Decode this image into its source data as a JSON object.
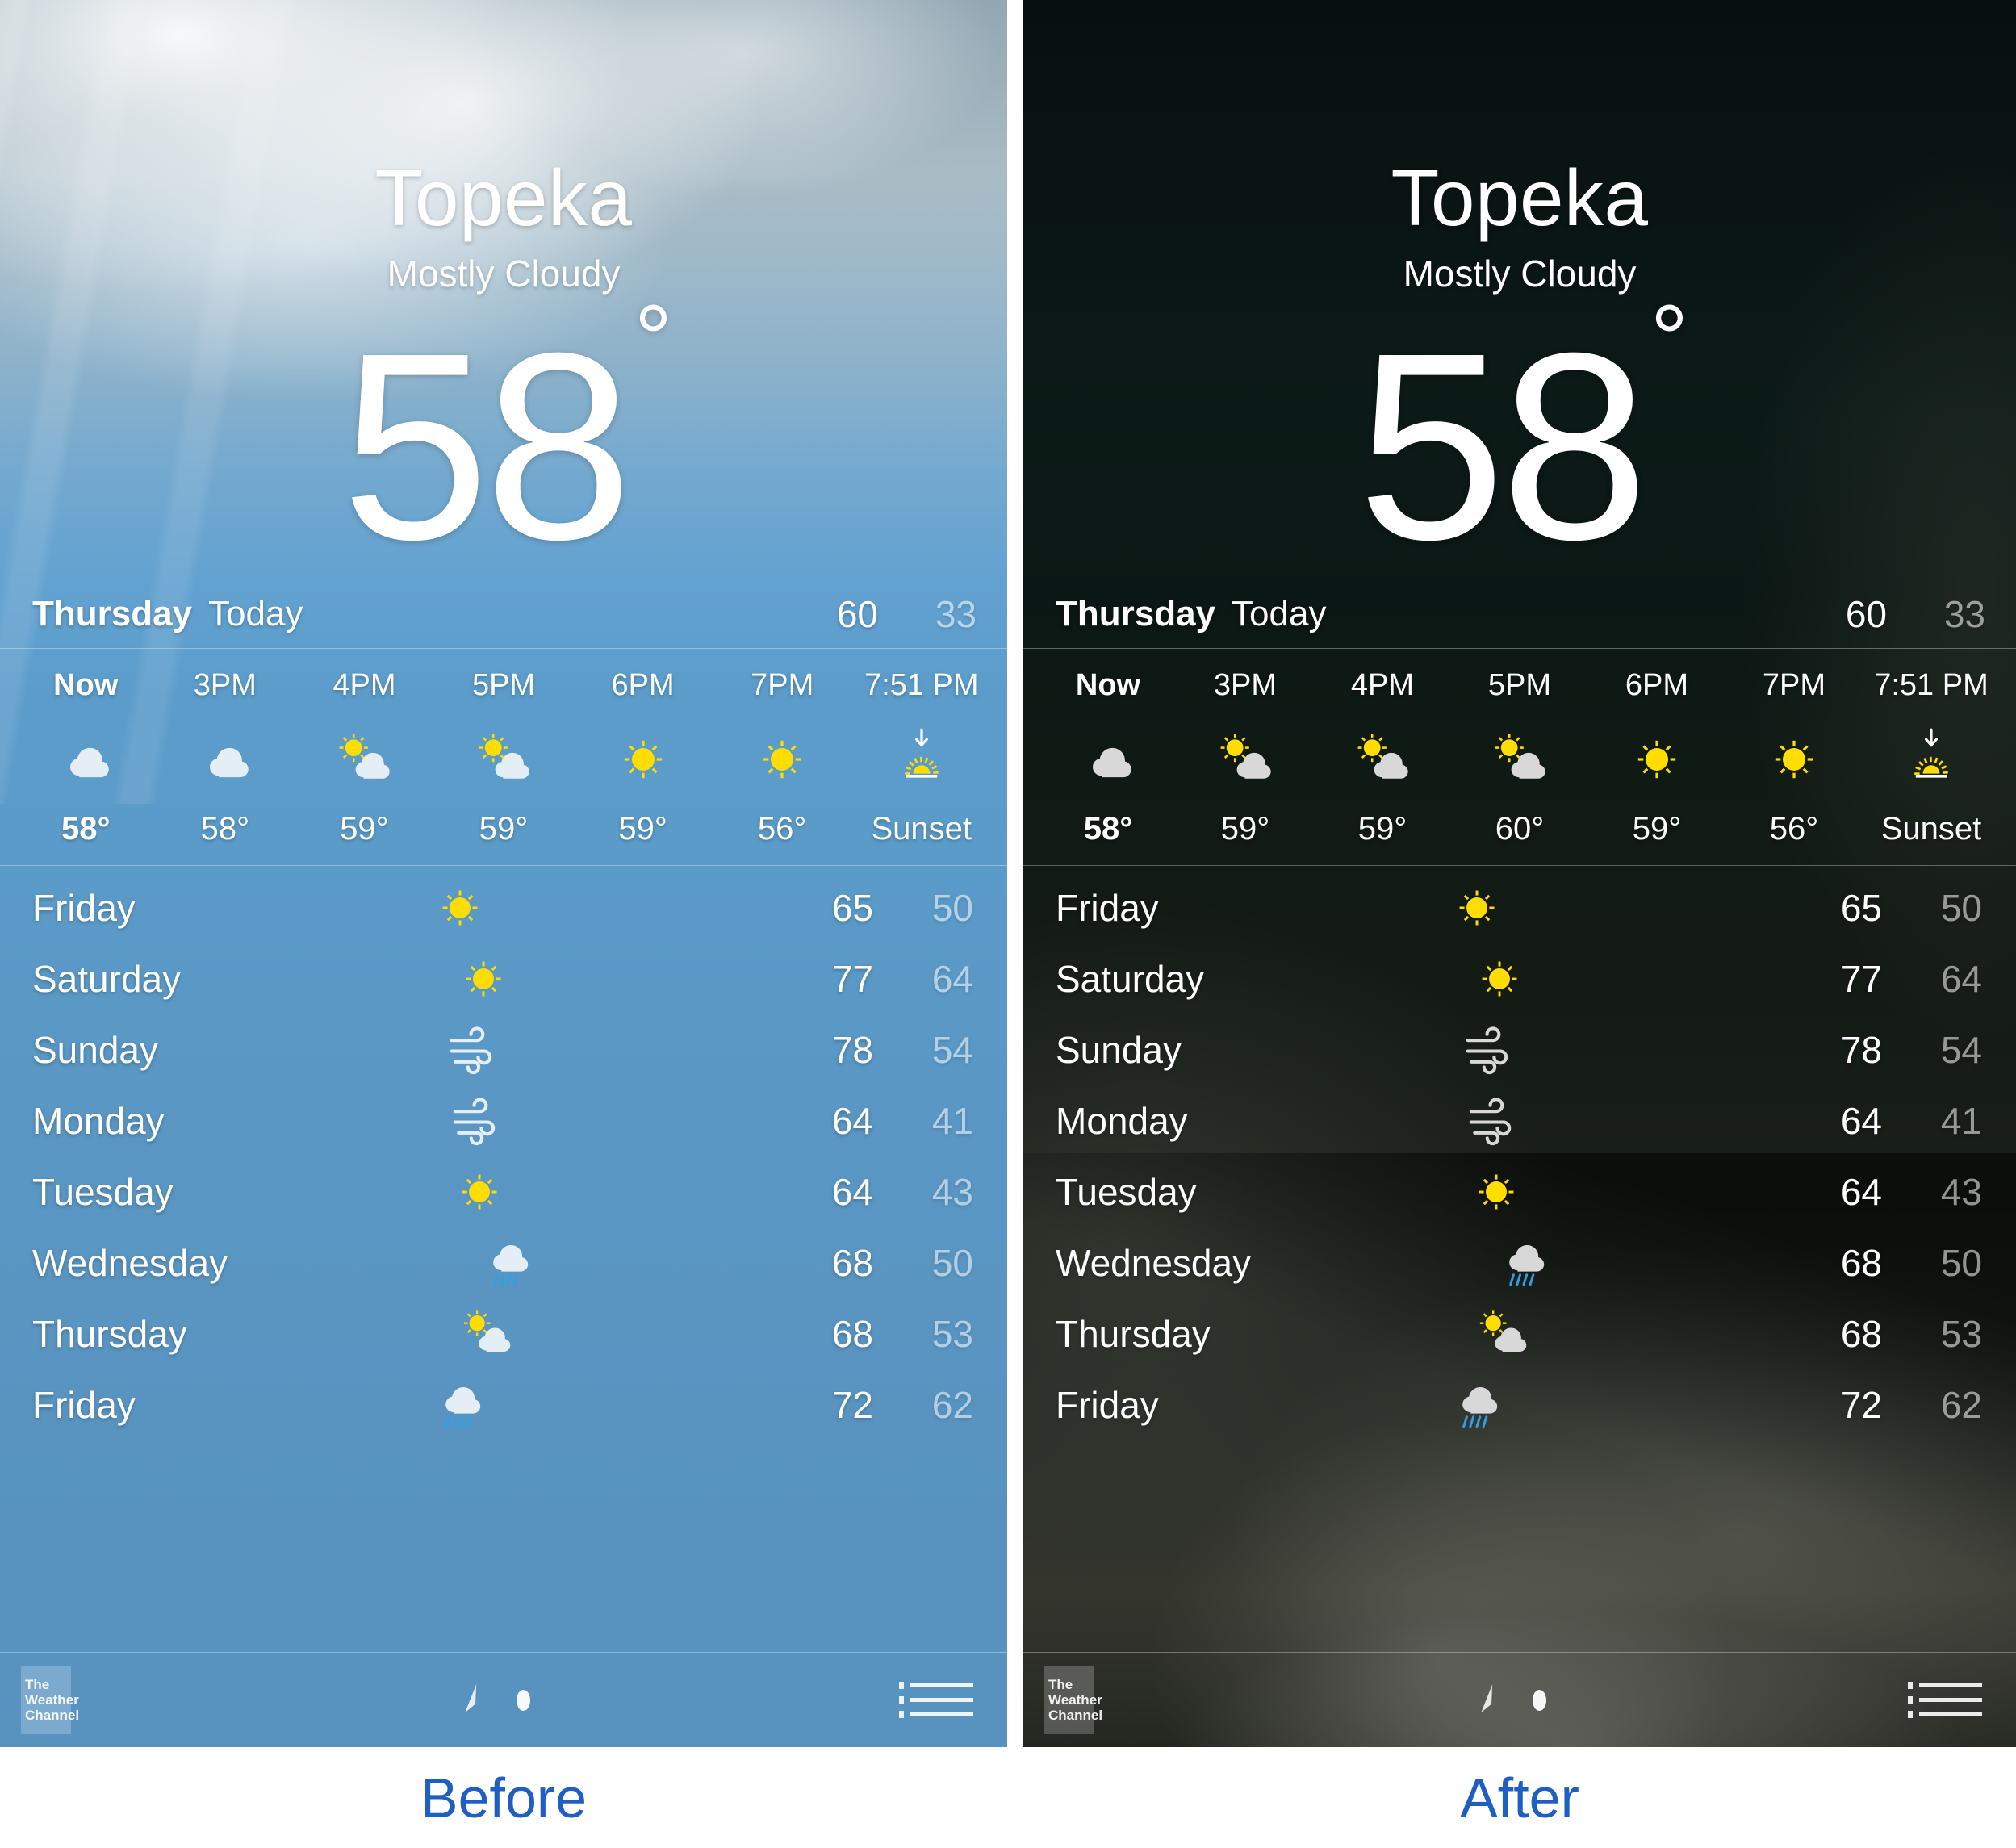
{
  "panels": [
    {
      "key": "before",
      "caption": "Before",
      "caption_color": "#1f5fc4",
      "theme": "light",
      "city": "Topeka",
      "condition": "Mostly Cloudy",
      "current_temp": "58",
      "degree": "°",
      "today": {
        "day": "Thursday",
        "label": "Today",
        "high": "60",
        "low": "33"
      },
      "hourly": [
        {
          "time": "Now",
          "icon": "cloud-icon",
          "temp": "58°"
        },
        {
          "time": "3PM",
          "icon": "cloud-icon",
          "temp": "58°"
        },
        {
          "time": "4PM",
          "icon": "sun-cloud-icon",
          "temp": "59°"
        },
        {
          "time": "5PM",
          "icon": "sun-cloud-icon",
          "temp": "59°"
        },
        {
          "time": "6PM",
          "icon": "sun-icon",
          "temp": "59°"
        },
        {
          "time": "7PM",
          "icon": "sun-icon",
          "temp": "56°"
        },
        {
          "time": "7:51 PM",
          "icon": "sunset-icon",
          "temp": "Sunset"
        }
      ],
      "daily": [
        {
          "day": "Friday",
          "icon": "sun-icon",
          "high": "65",
          "low": "50"
        },
        {
          "day": "Saturday",
          "icon": "sun-icon",
          "high": "77",
          "low": "64"
        },
        {
          "day": "Sunday",
          "icon": "wind-icon",
          "high": "78",
          "low": "54"
        },
        {
          "day": "Monday",
          "icon": "wind-icon",
          "high": "64",
          "low": "41"
        },
        {
          "day": "Tuesday",
          "icon": "sun-icon",
          "high": "64",
          "low": "43"
        },
        {
          "day": "Wednesday",
          "icon": "rain-cloud-icon",
          "high": "68",
          "low": "50"
        },
        {
          "day": "Thursday",
          "icon": "sun-cloud-icon",
          "high": "68",
          "low": "53"
        },
        {
          "day": "Friday",
          "icon": "rain-cloud-icon",
          "high": "72",
          "low": "62"
        }
      ],
      "bottom": {
        "attribution": [
          "The",
          "Weather",
          "Channel"
        ],
        "location_icon": "location-arrow-icon",
        "page_dot": "page-indicator-dot",
        "list_icon": "list-icon"
      }
    },
    {
      "key": "after",
      "caption": "After",
      "caption_color": "#1f5fc4",
      "theme": "dark",
      "city": "Topeka",
      "condition": "Mostly Cloudy",
      "current_temp": "58",
      "degree": "°",
      "today": {
        "day": "Thursday",
        "label": "Today",
        "high": "60",
        "low": "33"
      },
      "hourly": [
        {
          "time": "Now",
          "icon": "cloud-icon",
          "temp": "58°"
        },
        {
          "time": "3PM",
          "icon": "sun-cloud-icon",
          "temp": "59°"
        },
        {
          "time": "4PM",
          "icon": "sun-cloud-icon",
          "temp": "59°"
        },
        {
          "time": "5PM",
          "icon": "sun-cloud-icon",
          "temp": "60°"
        },
        {
          "time": "6PM",
          "icon": "sun-icon",
          "temp": "59°"
        },
        {
          "time": "7PM",
          "icon": "sun-icon",
          "temp": "56°"
        },
        {
          "time": "7:51 PM",
          "icon": "sunset-icon",
          "temp": "Sunset"
        }
      ],
      "daily": [
        {
          "day": "Friday",
          "icon": "sun-icon",
          "high": "65",
          "low": "50"
        },
        {
          "day": "Saturday",
          "icon": "sun-icon",
          "high": "77",
          "low": "64"
        },
        {
          "day": "Sunday",
          "icon": "wind-icon",
          "high": "78",
          "low": "54"
        },
        {
          "day": "Monday",
          "icon": "wind-icon",
          "high": "64",
          "low": "41"
        },
        {
          "day": "Tuesday",
          "icon": "sun-icon",
          "high": "64",
          "low": "43"
        },
        {
          "day": "Wednesday",
          "icon": "rain-cloud-icon",
          "high": "68",
          "low": "50"
        },
        {
          "day": "Thursday",
          "icon": "sun-cloud-icon",
          "high": "68",
          "low": "53"
        },
        {
          "day": "Friday",
          "icon": "rain-cloud-icon",
          "high": "72",
          "low": "62"
        }
      ],
      "bottom": {
        "attribution": [
          "The",
          "Weather",
          "Channel"
        ],
        "location_icon": "location-arrow-icon",
        "page_dot": "page-indicator-dot",
        "list_icon": "list-icon"
      }
    }
  ],
  "colors": {
    "sun_yellow": "#ffdd00",
    "cloud_light": "#e6eef5",
    "cloud_dark": "#d8d8d8",
    "rain_blue": "#31a0e0",
    "panel_blue": "#5b9bc9",
    "caption_blue": "#1f5fc4"
  }
}
